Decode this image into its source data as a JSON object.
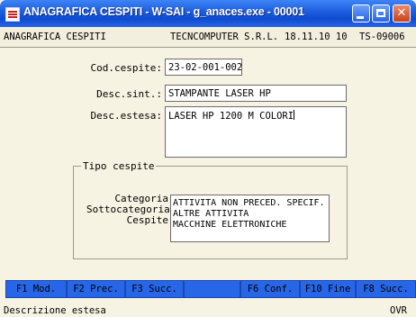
{
  "window": {
    "title": "ANAGRAFICA CESPITI - W-SAI - g_anaces.exe - 00001",
    "buttons": {
      "minimize": "minimize",
      "maximize": "maximize",
      "close": "✕"
    }
  },
  "header": {
    "screen": "ANAGRAFICA CESPITI",
    "company": "TECNCOMPUTER S.R.L.",
    "date": "18.11.10 10",
    "code": "TS-09006"
  },
  "form": {
    "cod_cespite": {
      "label": "Cod.cespite:",
      "value": "23-02-001-002"
    },
    "desc_sint": {
      "label": "Desc.sint.:",
      "value": "STAMPANTE LASER HP"
    },
    "desc_estesa": {
      "label": "Desc.estesa:",
      "value": "LASER HP 1200 M COLORI"
    }
  },
  "tipo_cespite": {
    "title": "Tipo cespite",
    "labels": [
      "Categoria",
      "Sottocategoria",
      "Cespite"
    ],
    "values": [
      "ATTIVITA NON PRECED. SPECIF.",
      "ALTRE ATTIVITA",
      "MACCHINE ELETTRONICHE"
    ]
  },
  "function_keys": [
    {
      "label": "F1  Mod."
    },
    {
      "label": "F2 Prec."
    },
    {
      "label": "F3 Succ."
    },
    {
      "label": ""
    },
    {
      "label": "F6 Conf."
    },
    {
      "label": "F10 Fine"
    },
    {
      "label": "F8 Succ."
    }
  ],
  "status": {
    "message": "Descrizione estesa",
    "mode": "OVR"
  },
  "colors": {
    "titlebar": "#1f5fe0",
    "background": "#f7f3e3",
    "function_key": "#2866e8"
  },
  "icons": {
    "app": "app-icon",
    "minimize": "minimize-icon",
    "maximize": "maximize-icon",
    "close": "close-icon"
  }
}
